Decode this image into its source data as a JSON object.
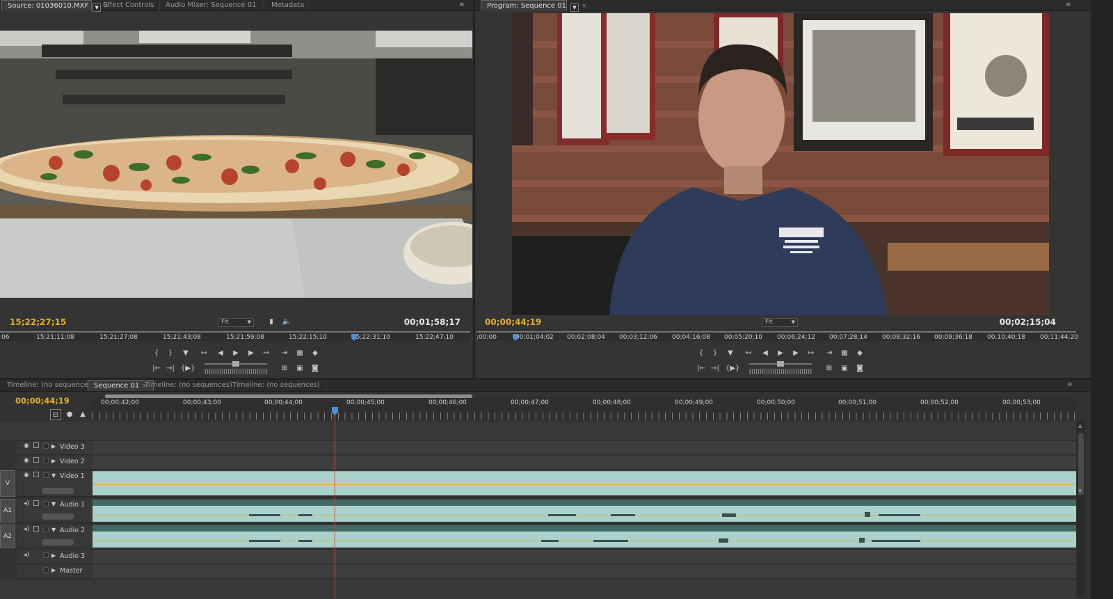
{
  "source_panel": {
    "tabs": [
      {
        "label": "Source: 01036010.MXF",
        "active": true
      },
      {
        "label": "Effect Controls"
      },
      {
        "label": "Audio Mixer: Sequence 01"
      },
      {
        "label": "Metadata"
      }
    ],
    "timecode_current": "15;22;27;15",
    "fit": "Fit",
    "duration": "00;01;58;17",
    "ruler": [
      "06",
      "15;21;11;08",
      "15;21;27;08",
      "15;21;43;08",
      "15;21;59;08",
      "15;22;15;10",
      "15;22;31;10",
      "15;22;47;10"
    ]
  },
  "program_panel": {
    "tab": "Program: Sequence 01",
    "timecode_current": "00;00;44;19",
    "fit": "Fit",
    "duration": "00;02;15;04",
    "ruler": [
      ";00;00",
      "00;01;04;02",
      "00;02;08;04",
      "00;03;12;06",
      "00;04;16;08",
      "00;05;20;10",
      "00;06;24;12",
      "00;07;28;14",
      "00;08;32;16",
      "00;09;36;18",
      "00;10;40;18",
      "00;11;44;20"
    ]
  },
  "timeline": {
    "tabs": [
      {
        "label": "Timeline: (no sequences)"
      },
      {
        "label": "Sequence 01",
        "active": true
      },
      {
        "label": "Timeline: (no sequences)"
      },
      {
        "label": "Timeline: (no sequences)"
      }
    ],
    "timecode": "00;00;44;19",
    "ruler": [
      "00;00;42;00",
      "00;00;43;00",
      "00;00;44;00",
      "00;00;45;00",
      "00;00;46;00",
      "00;00;47;00",
      "00;00;48;00",
      "00;00;49;00",
      "00;00;50;00",
      "00;00;51;00",
      "00;00;52;00",
      "00;00;53;00"
    ],
    "tracks": {
      "video3": "Video 3",
      "video2": "Video 2",
      "video1": "Video 1",
      "audio1": "Audio 1",
      "audio2": "Audio 2",
      "audio3": "Audio 3",
      "master": "Master"
    },
    "targets": {
      "v": "V",
      "a1": "A1",
      "a2": "A2"
    }
  },
  "icons": [
    "panel-menu-icon",
    "eye-icon",
    "film-icon",
    "speaker-icon",
    "play-icon",
    "step-back-icon",
    "step-forward-icon",
    "marker-icon",
    "snap-icon",
    "insert-icon",
    "overwrite-icon",
    "export-frame-icon"
  ],
  "colors": {
    "timecode_yellow": "#e8b020",
    "clip_teal": "#a9d2cc",
    "playhead_red": "#d14a3a",
    "playhead_blue": "#4f8fd8"
  }
}
